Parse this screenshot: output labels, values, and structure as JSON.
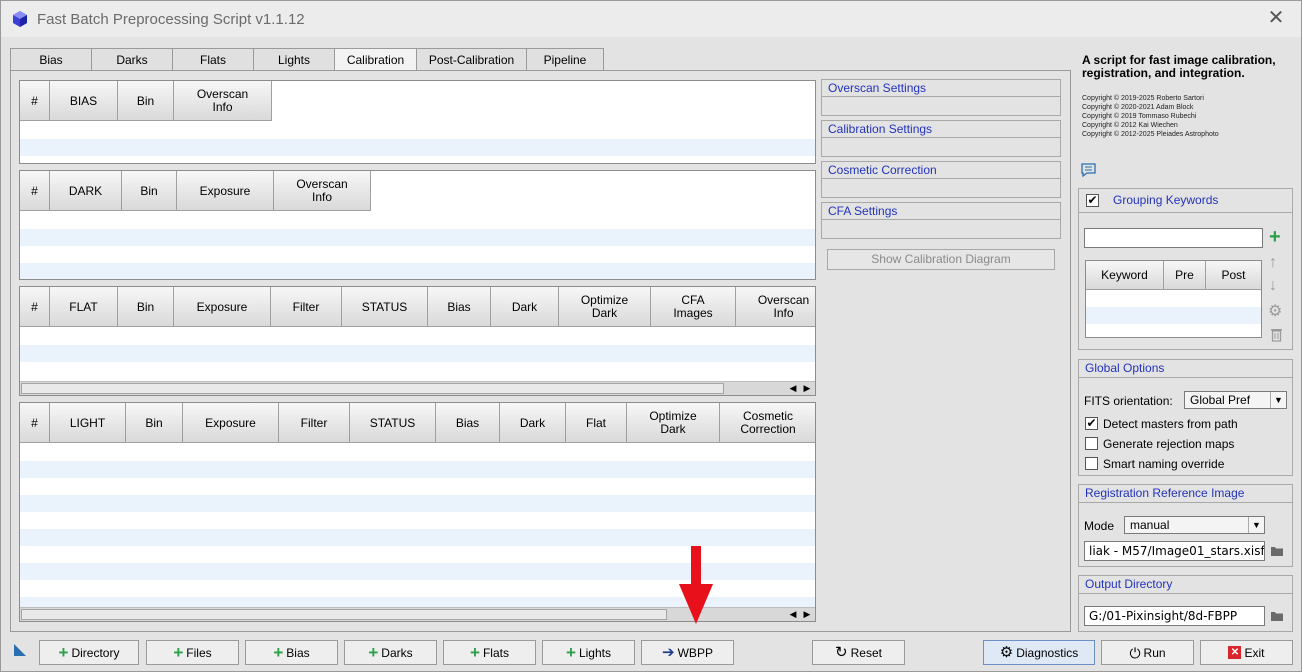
{
  "window": {
    "title": "Fast Batch Preprocessing Script v1.1.12",
    "close_glyph": "✕"
  },
  "tabs": [
    {
      "label": "Bias"
    },
    {
      "label": "Darks"
    },
    {
      "label": "Flats"
    },
    {
      "label": "Lights"
    },
    {
      "label": "Calibration",
      "active": true
    },
    {
      "label": "Post-Calibration"
    },
    {
      "label": "Pipeline"
    }
  ],
  "tables": {
    "bias": {
      "headers": [
        "#",
        "BIAS",
        "Bin",
        "Overscan\nInfo"
      ]
    },
    "dark": {
      "headers": [
        "#",
        "DARK",
        "Bin",
        "Exposure",
        "Overscan\nInfo"
      ]
    },
    "flat": {
      "headers": [
        "#",
        "FLAT",
        "Bin",
        "Exposure",
        "Filter",
        "STATUS",
        "Bias",
        "Dark",
        "Optimize\nDark",
        "CFA\nImages",
        "Overscan\nInfo"
      ]
    },
    "light": {
      "headers": [
        "#",
        "LIGHT",
        "Bin",
        "Exposure",
        "Filter",
        "STATUS",
        "Bias",
        "Dark",
        "Flat",
        "Optimize\nDark",
        "Cosmetic\nCorrection"
      ]
    }
  },
  "sections": {
    "overscan": "Overscan Settings",
    "calibration": "Calibration Settings",
    "cosmetic": "Cosmetic Correction",
    "cfa": "CFA Settings",
    "show_diagram": "Show Calibration Diagram"
  },
  "sidebar": {
    "description": "A script for fast image calibration, registration, and integration.",
    "copyright": [
      "Copyright © 2019-2025 Roberto Sartori",
      "Copyright © 2020-2021 Adam Block",
      "Copyright © 2019 Tommaso Rubechi",
      "Copyright © 2012 Kai Wiechen",
      "Copyright © 2012-2025 Pleiades Astrophoto"
    ],
    "grouping": {
      "title": "Grouping Keywords",
      "enabled": true,
      "input_value": "",
      "headers": [
        "Keyword",
        "Pre",
        "Post"
      ]
    },
    "global_options": {
      "title": "Global Options",
      "fits_label": "FITS orientation:",
      "fits_value": "Global Pref",
      "detect_masters": {
        "label": "Detect masters from path",
        "checked": true
      },
      "rejection_maps": {
        "label": "Generate rejection maps",
        "checked": false
      },
      "smart_naming": {
        "label": "Smart naming override",
        "checked": false
      }
    },
    "registration": {
      "title": "Registration Reference Image",
      "mode_label": "Mode",
      "mode_value": "manual",
      "path": "liak - M57/Image01_stars.xisf"
    },
    "output": {
      "title": "Output Directory",
      "path": "G:/01-Pixinsight/8d-FBPP"
    }
  },
  "buttons": {
    "directory": "Directory",
    "files": "Files",
    "bias": "Bias",
    "darks": "Darks",
    "flats": "Flats",
    "lights": "Lights",
    "wbpp": "WBPP",
    "reset": "Reset",
    "diagnostics": "Diagnostics",
    "run": "Run",
    "exit": "Exit"
  },
  "colors": {
    "annotation_arrow": "#e8101a",
    "section_header": "#2233bb",
    "row_alt": "#eaf2fc"
  }
}
